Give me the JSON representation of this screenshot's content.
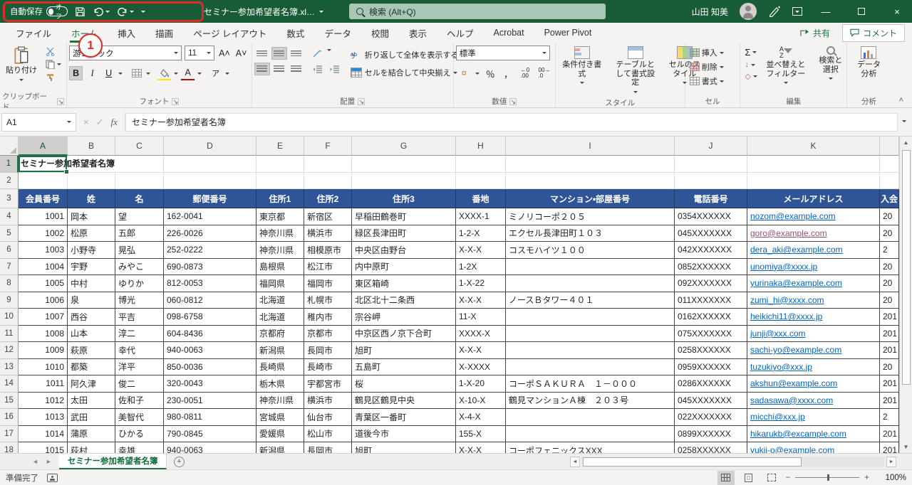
{
  "colors": {
    "titlebar_green": "#185C37",
    "accent_green": "#217346",
    "table_header_blue": "#2F5597",
    "link_blue": "#0563C1",
    "link_visited": "#954F72",
    "annotation_red": "#DE2B25",
    "fill_color_yellow": "#FFE600",
    "font_color_red": "#C00000"
  },
  "title_bar": {
    "autosave_label": "自動保存",
    "autosave_state": "オフ",
    "filename": "セミナー参加希望者名簿.xl…",
    "search_placeholder": "検索 (Alt+Q)",
    "user_name": "山田 知美"
  },
  "tabs": {
    "items": [
      {
        "label": "ファイル"
      },
      {
        "label": "ホーム",
        "active": true
      },
      {
        "label": "挿入"
      },
      {
        "label": "描画"
      },
      {
        "label": "ページ レイアウト"
      },
      {
        "label": "数式"
      },
      {
        "label": "データ"
      },
      {
        "label": "校閲"
      },
      {
        "label": "表示"
      },
      {
        "label": "ヘルプ"
      },
      {
        "label": "Acrobat"
      },
      {
        "label": "Power Pivot"
      }
    ],
    "share": "共有",
    "comments": "コメント"
  },
  "ribbon": {
    "paste": "貼り付け",
    "font_name": "游ゴシック",
    "font_size": "11",
    "bold": "B",
    "italic": "I",
    "underline": "U",
    "phonetic": "ア",
    "wrap_text": "折り返して全体を表示する",
    "merge_center": "セルを結合して中央揃え",
    "number_format": "標準",
    "percent": "％",
    "comma": "，",
    "currency": "¤",
    "inc_decimal": "←0 .00",
    "dec_decimal": "00→ .0",
    "conditional_formatting": "条件付き書式",
    "format_as_table": "テーブルとして書式設定",
    "cell_styles": "セルのスタイル",
    "insert": "挿入",
    "delete": "削除",
    "format": "書式",
    "autosum": "Σ",
    "fill": "↓",
    "clear": "◇",
    "sort_filter": "並べ替えとフィルター",
    "find_select": "検索と選択",
    "data_analysis": "データ分析",
    "groups": {
      "clipboard": "クリップボード",
      "font": "フォント",
      "align": "配置",
      "number": "数値",
      "styles": "スタイル",
      "cells": "セル",
      "edit": "編集",
      "analyze": "分析"
    }
  },
  "formula_bar": {
    "name_box": "A1",
    "formula": "セミナー参加希望者名簿"
  },
  "grid": {
    "column_letters": [
      "A",
      "B",
      "C",
      "D",
      "E",
      "F",
      "G",
      "H",
      "I",
      "J",
      "K",
      ""
    ],
    "title_cell": "セミナー参加希望者名簿",
    "headers": [
      "会員番号",
      "姓",
      "名",
      "郵便番号",
      "住所1",
      "住所2",
      "住所3",
      "番地",
      "マンション・部屋番号",
      "電話番号",
      "メールアドレス",
      "入会"
    ],
    "rows": [
      [
        "1001",
        "岡本",
        "望",
        "162-0041",
        "東京都",
        "新宿区",
        "早稲田鶴巻町",
        "XXXX-1",
        "ミノリコーポ２０５",
        "0354XXXXXX",
        "nozom@example.com",
        "20"
      ],
      [
        "1002",
        "松原",
        "五郎",
        "226-0026",
        "神奈川県",
        "横浜市",
        "緑区長津田町",
        "1-2-X",
        "エクセル長津田町１０３",
        "045XXXXXXX",
        "goro@example.com",
        "20"
      ],
      [
        "1003",
        "小野寺",
        "晃弘",
        "252-0222",
        "神奈川県",
        "相模原市",
        "中央区由野台",
        "X-X-X",
        "コスモハイツ１００",
        "042XXXXXXX",
        "dera_aki@example.com",
        "2"
      ],
      [
        "1004",
        "宇野",
        "みやこ",
        "690-0873",
        "島根県",
        "松江市",
        "内中原町",
        "1-2X",
        "",
        "0852XXXXXX",
        "unomiya@xxxx.jp",
        "20"
      ],
      [
        "1005",
        "中村",
        "ゆりか",
        "812-0053",
        "福岡県",
        "福岡市",
        "東区箱崎",
        "1-X-22",
        "",
        "092XXXXXXX",
        "yurinaka@example.com",
        "20"
      ],
      [
        "1006",
        "泉",
        "博光",
        "060-0812",
        "北海道",
        "札幌市",
        "北区北十二条西",
        "X-X-X",
        "ノースＢタワー４０１",
        "011XXXXXXX",
        "zumi_hi@xxxx.com",
        "20"
      ],
      [
        "1007",
        "西谷",
        "平吉",
        "098-6758",
        "北海道",
        "稚内市",
        "宗谷岬",
        "11-X",
        "",
        "0162XXXXXX",
        "heikichi11@xxxx.jp",
        "201"
      ],
      [
        "1008",
        "山本",
        "淳二",
        "604-8436",
        "京都府",
        "京都市",
        "中京区西ノ京下合町",
        "XXXX-X",
        "",
        "075XXXXXXX",
        "junji@xxx.com",
        "201"
      ],
      [
        "1009",
        "萩原",
        "幸代",
        "940-0063",
        "新潟県",
        "長岡市",
        "旭町",
        "X-X-X",
        "",
        "0258XXXXXX",
        "sachi-yo@example.com",
        "201"
      ],
      [
        "1010",
        "都築",
        "洋平",
        "850-0036",
        "長崎県",
        "長崎市",
        "五島町",
        "X-XXXX",
        "",
        "0959XXXXXX",
        "tuzukiyo@xxx.jp",
        "20"
      ],
      [
        "1011",
        "阿久津",
        "俊二",
        "320-0043",
        "栃木県",
        "宇都宮市",
        "桜",
        "1-X-20",
        "コーポＳＡＫＵＲＡ　１－０００",
        "0286XXXXXX",
        "akshun@example.com",
        "201"
      ],
      [
        "1012",
        "太田",
        "佐和子",
        "230-0051",
        "神奈川県",
        "横浜市",
        "鶴見区鶴見中央",
        "X-10-X",
        "鶴見マンションＡ棟　２０３号",
        "045XXXXXXX",
        "sadasawa@xxxx.com",
        "201"
      ],
      [
        "1013",
        "武田",
        "美智代",
        "980-0811",
        "宮城県",
        "仙台市",
        "青葉区一番町",
        "X-4-X",
        "",
        "022XXXXXXX",
        "micchi@xxx.jp",
        "2"
      ],
      [
        "1014",
        "蒲原",
        "ひかる",
        "790-0845",
        "愛媛県",
        "松山市",
        "道後今市",
        "155-X",
        "",
        "0899XXXXXX",
        "hikarukb@excample.com",
        "201"
      ],
      [
        "1015",
        "荻村",
        "幸雄",
        "940-0063",
        "新潟県",
        "長岡市",
        "旭町",
        "X-X-X",
        "コーポフェニックスXXX",
        "0258XXXXXX",
        "yukii-o@example.com",
        "201"
      ]
    ],
    "visited_email": "goro@example.com"
  },
  "sheet_tabs": {
    "active": "セミナー参加希望者名簿"
  },
  "status_bar": {
    "ready": "準備完了",
    "zoom_level": "100%"
  },
  "annotation": {
    "callout": "1"
  }
}
